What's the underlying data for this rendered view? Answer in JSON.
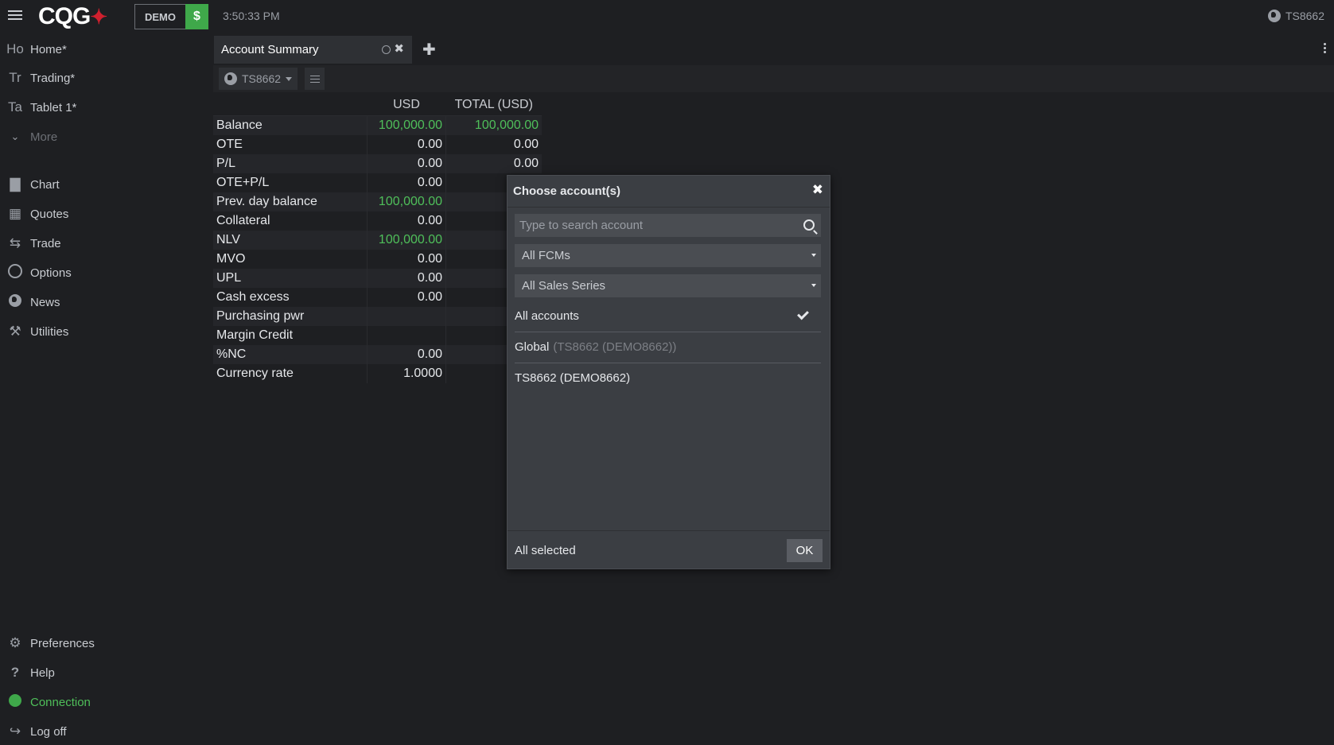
{
  "header": {
    "logo_text": "CQG",
    "demo_badge": "DEMO",
    "demo_currency": "$",
    "clock": "3:50:33 PM",
    "account": "TS8662"
  },
  "sidebar": {
    "workspaces": [
      {
        "abbr": "Ho",
        "label": "Home*"
      },
      {
        "abbr": "Tr",
        "label": "Trading*"
      },
      {
        "abbr": "Ta",
        "label": "Tablet 1*"
      }
    ],
    "more_label": "More",
    "tools": [
      {
        "label": "Chart",
        "icon": "chart-icon"
      },
      {
        "label": "Quotes",
        "icon": "table-icon"
      },
      {
        "label": "Trade",
        "icon": "exchange-icon"
      },
      {
        "label": "Options",
        "icon": "circle-icon"
      },
      {
        "label": "News",
        "icon": "globe-icon"
      },
      {
        "label": "Utilities",
        "icon": "wrench-icon"
      }
    ],
    "bottom": [
      {
        "label": "Preferences",
        "icon": "gears-icon"
      },
      {
        "label": "Help",
        "icon": "question-icon"
      },
      {
        "label": "Connection",
        "icon": "status-dot-icon"
      },
      {
        "label": "Log off",
        "icon": "logoff-icon"
      }
    ]
  },
  "tabs": {
    "active_label": "Account Summary"
  },
  "toolbar": {
    "account_selector": "TS8662"
  },
  "summary": {
    "headers": [
      "",
      "USD",
      "TOTAL (USD)"
    ],
    "rows": [
      {
        "name": "Balance",
        "usd": "100,000.00",
        "total": "100,000.00",
        "green": true
      },
      {
        "name": "OTE",
        "usd": "0.00",
        "total": "0.00",
        "green": false
      },
      {
        "name": "P/L",
        "usd": "0.00",
        "total": "0.00",
        "green": false
      },
      {
        "name": "OTE+P/L",
        "usd": "0.00",
        "total": "",
        "green": false
      },
      {
        "name": "Prev. day balance",
        "usd": "100,000.00",
        "total": "100,0",
        "green": true
      },
      {
        "name": "Collateral",
        "usd": "0.00",
        "total": "",
        "green": false
      },
      {
        "name": "NLV",
        "usd": "100,000.00",
        "total": "100,0",
        "green": true
      },
      {
        "name": "MVO",
        "usd": "0.00",
        "total": "",
        "green": false
      },
      {
        "name": "UPL",
        "usd": "0.00",
        "total": "",
        "green": false
      },
      {
        "name": "Cash excess",
        "usd": "0.00",
        "total": "",
        "green": false
      },
      {
        "name": "Purchasing pwr",
        "usd": "",
        "total": "100,0",
        "green": true
      },
      {
        "name": "Margin Credit",
        "usd": "",
        "total": "",
        "green": false
      },
      {
        "name": "%NC",
        "usd": "0.00",
        "total": "",
        "green": false
      },
      {
        "name": "Currency rate",
        "usd": "1.0000",
        "total": "",
        "green": false
      }
    ]
  },
  "dialog": {
    "title": "Choose account(s)",
    "search_placeholder": "Type to search account",
    "fcm_filter": "All FCMs",
    "sales_filter": "All Sales Series",
    "all_accounts": "All accounts",
    "global_label": "Global",
    "global_sub": "(TS8662 (DEMO8662))",
    "account_item": "TS8662 (DEMO8662)",
    "status": "All selected",
    "ok": "OK"
  },
  "colors": {
    "positive": "#4fbf5a",
    "brand_red": "#d0202e",
    "demo_green": "#3fa84a"
  }
}
